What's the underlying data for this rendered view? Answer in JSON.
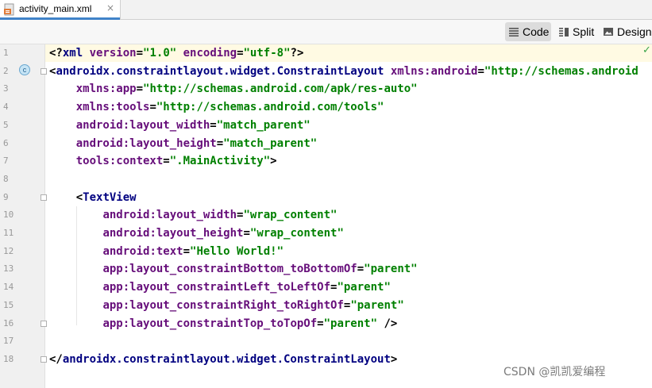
{
  "tab": {
    "label": "activity_main.xml",
    "close": "×"
  },
  "view_modes": {
    "code": "Code",
    "split": "Split",
    "design": "Design"
  },
  "badge": "c",
  "status_check": "✓",
  "lines": [
    {
      "n": "1",
      "code": [
        [
          "pun",
          "<?"
        ],
        [
          "tag",
          "xml "
        ],
        [
          "attr",
          "version"
        ],
        [
          "pun",
          "="
        ],
        [
          "val",
          "\"1.0\""
        ],
        [
          "pun",
          " "
        ],
        [
          "attr",
          "encoding"
        ],
        [
          "pun",
          "="
        ],
        [
          "val",
          "\"utf-8\""
        ],
        [
          "pun",
          "?>"
        ]
      ]
    },
    {
      "n": "2",
      "code": [
        [
          "pun",
          "<"
        ],
        [
          "tag",
          "androidx.constraintlayout.widget.ConstraintLayout "
        ],
        [
          "ns",
          "xmlns:android"
        ],
        [
          "pun",
          "="
        ],
        [
          "val",
          "\"http://schemas.android"
        ]
      ]
    },
    {
      "n": "3",
      "code": [
        [
          "pun",
          "    "
        ],
        [
          "ns",
          "xmlns:app"
        ],
        [
          "pun",
          "="
        ],
        [
          "val",
          "\"http://schemas.android.com/apk/res-auto\""
        ]
      ]
    },
    {
      "n": "4",
      "code": [
        [
          "pun",
          "    "
        ],
        [
          "ns",
          "xmlns:tools"
        ],
        [
          "pun",
          "="
        ],
        [
          "val",
          "\"http://schemas.android.com/tools\""
        ]
      ]
    },
    {
      "n": "5",
      "code": [
        [
          "pun",
          "    "
        ],
        [
          "attr",
          "android:layout_width"
        ],
        [
          "pun",
          "="
        ],
        [
          "val",
          "\"match_parent\""
        ]
      ]
    },
    {
      "n": "6",
      "code": [
        [
          "pun",
          "    "
        ],
        [
          "attr",
          "android:layout_height"
        ],
        [
          "pun",
          "="
        ],
        [
          "val",
          "\"match_parent\""
        ]
      ]
    },
    {
      "n": "7",
      "code": [
        [
          "pun",
          "    "
        ],
        [
          "attr",
          "tools:context"
        ],
        [
          "pun",
          "="
        ],
        [
          "val",
          "\".MainActivity\""
        ],
        [
          "pun",
          ">"
        ]
      ]
    },
    {
      "n": "8",
      "code": []
    },
    {
      "n": "9",
      "code": [
        [
          "pun",
          "    <"
        ],
        [
          "tag",
          "TextView"
        ]
      ]
    },
    {
      "n": "10",
      "code": [
        [
          "pun",
          "        "
        ],
        [
          "attr",
          "android:layout_width"
        ],
        [
          "pun",
          "="
        ],
        [
          "val",
          "\"wrap_content\""
        ]
      ]
    },
    {
      "n": "11",
      "code": [
        [
          "pun",
          "        "
        ],
        [
          "attr",
          "android:layout_height"
        ],
        [
          "pun",
          "="
        ],
        [
          "val",
          "\"wrap_content\""
        ]
      ]
    },
    {
      "n": "12",
      "code": [
        [
          "pun",
          "        "
        ],
        [
          "attr",
          "android:text"
        ],
        [
          "pun",
          "="
        ],
        [
          "val",
          "\"Hello World!\""
        ]
      ]
    },
    {
      "n": "13",
      "code": [
        [
          "pun",
          "        "
        ],
        [
          "attr",
          "app:layout_constraintBottom_toBottomOf"
        ],
        [
          "pun",
          "="
        ],
        [
          "val",
          "\"parent\""
        ]
      ]
    },
    {
      "n": "14",
      "code": [
        [
          "pun",
          "        "
        ],
        [
          "attr",
          "app:layout_constraintLeft_toLeftOf"
        ],
        [
          "pun",
          "="
        ],
        [
          "val",
          "\"parent\""
        ]
      ]
    },
    {
      "n": "15",
      "code": [
        [
          "pun",
          "        "
        ],
        [
          "attr",
          "app:layout_constraintRight_toRightOf"
        ],
        [
          "pun",
          "="
        ],
        [
          "val",
          "\"parent\""
        ]
      ]
    },
    {
      "n": "16",
      "code": [
        [
          "pun",
          "        "
        ],
        [
          "attr",
          "app:layout_constraintTop_toTopOf"
        ],
        [
          "pun",
          "="
        ],
        [
          "val",
          "\"parent\""
        ],
        [
          "pun",
          " />"
        ]
      ]
    },
    {
      "n": "17",
      "code": []
    },
    {
      "n": "18",
      "code": [
        [
          "pun",
          "</"
        ],
        [
          "tag",
          "androidx.constraintlayout.widget.ConstraintLayout"
        ],
        [
          "pun",
          ">"
        ]
      ]
    }
  ],
  "watermark": "CSDN @凯凯爱编程"
}
